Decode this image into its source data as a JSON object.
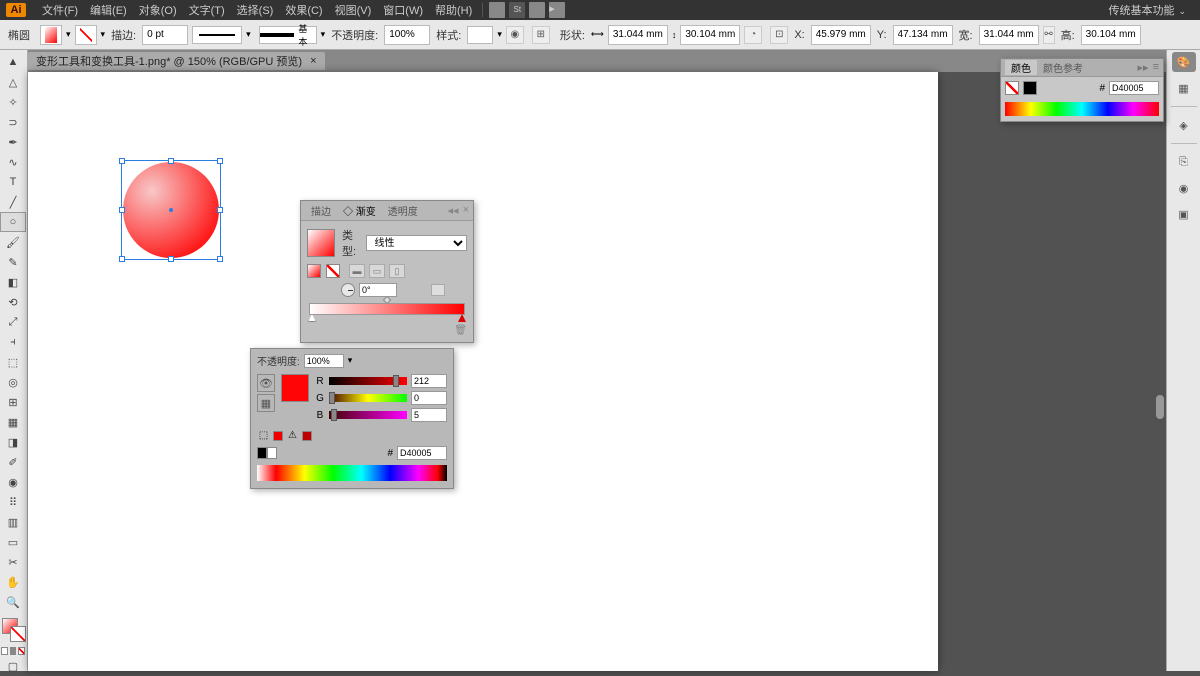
{
  "menu": {
    "items": [
      "文件(F)",
      "编辑(E)",
      "对象(O)",
      "文字(T)",
      "选择(S)",
      "效果(C)",
      "视图(V)",
      "窗口(W)",
      "帮助(H)"
    ]
  },
  "workspace": {
    "label": "传统基本功能"
  },
  "control": {
    "tool": "椭圆",
    "stroke_lbl": "描边:",
    "stroke": "0 pt",
    "profile": "基本",
    "opacity_lbl": "不透明度:",
    "opacity": "100%",
    "style_lbl": "样式:",
    "shape_lbl": "形状:",
    "sw": "31.044 mm",
    "sh": "30.104 mm",
    "x_lbl": "X:",
    "x": "45.979 mm",
    "y_lbl": "Y:",
    "y": "47.134 mm",
    "w_lbl": "宽:",
    "w": "31.044 mm",
    "h_lbl": "高:",
    "h": "30.104 mm"
  },
  "doc": {
    "title": "变形工具和变换工具-1.png* @ 150% (RGB/GPU 预览)"
  },
  "colorPanel": {
    "tab1": "颜色",
    "tab2": "颜色参考",
    "hex": "D40005"
  },
  "grad": {
    "tab1": "描边",
    "tab2": "◇ 渐变",
    "tab3": "透明度",
    "type_lbl": "类型:",
    "type": "线性",
    "angle": "0°"
  },
  "rgb": {
    "opacity_lbl": "不透明度:",
    "opacity": "100%",
    "r_lbl": "R",
    "r": "212",
    "g_lbl": "G",
    "g": "0",
    "b_lbl": "B",
    "b": "5",
    "hex_lbl": "#",
    "hex": "D40005"
  }
}
